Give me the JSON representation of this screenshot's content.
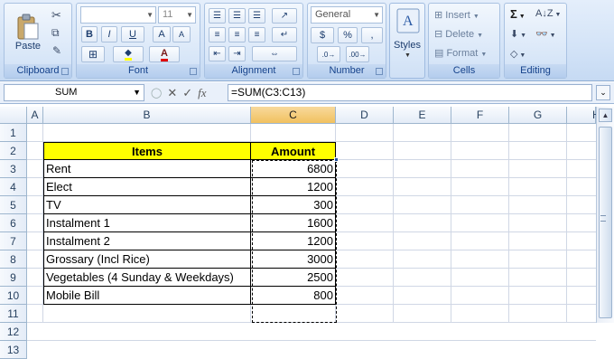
{
  "ribbon": {
    "clipboard": {
      "title": "Clipboard",
      "paste_label": "Paste"
    },
    "font": {
      "title": "Font",
      "font_name": "",
      "font_size": "11",
      "bold": "B",
      "italic": "I",
      "underline": "U",
      "grow": "A",
      "shrink": "A",
      "font_color": "A"
    },
    "alignment": {
      "title": "Alignment"
    },
    "number": {
      "title": "Number",
      "format": "General",
      "currency": "$",
      "percent": "%",
      "comma": ","
    },
    "styles": {
      "label": "Styles"
    },
    "cells": {
      "title": "Cells",
      "insert": "Insert",
      "delete": "Delete",
      "format": "Format"
    },
    "editing": {
      "title": "Editing",
      "sum": "Σ"
    }
  },
  "formula_bar": {
    "name_box": "SUM",
    "formula": "=SUM(C3:C13)",
    "fx": "fx"
  },
  "columns": [
    "A",
    "B",
    "C",
    "D",
    "E",
    "F",
    "G",
    "H"
  ],
  "rows": [
    "1",
    "2",
    "3",
    "4",
    "5",
    "6",
    "7",
    "8",
    "9",
    "10",
    "11",
    "12",
    "13"
  ],
  "table": {
    "header_items": "Items",
    "header_amount": "Amount",
    "rows": [
      {
        "item": "Rent",
        "amount": "6800"
      },
      {
        "item": "Elect",
        "amount": "1200"
      },
      {
        "item": "TV",
        "amount": "300"
      },
      {
        "item": "Instalment 1",
        "amount": "1600"
      },
      {
        "item": "Instalment 2",
        "amount": "1200"
      },
      {
        "item": "Grossary (Incl Rice)",
        "amount": "3000"
      },
      {
        "item": "Vegetables (4 Sunday & Weekdays)",
        "amount": "2500"
      },
      {
        "item": "Mobile Bill",
        "amount": "800"
      }
    ]
  },
  "colors": {
    "header_fill": "#ffff00",
    "selected_column": "#f1c15f",
    "ribbon_text": "#15428b"
  }
}
